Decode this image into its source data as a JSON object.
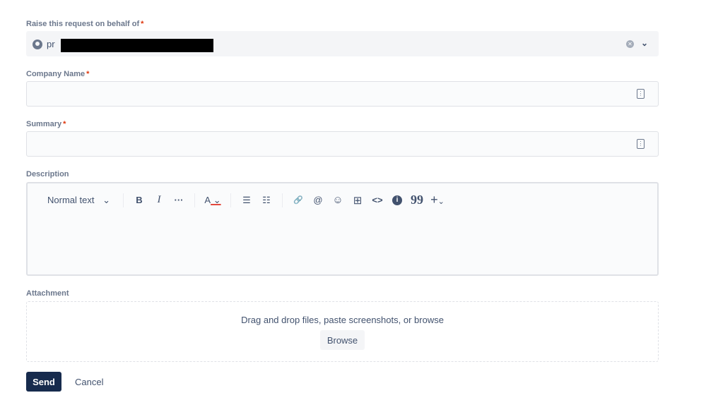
{
  "fields": {
    "behalf": {
      "label": "Raise this request on behalf of",
      "required": "*",
      "value": "pr"
    },
    "company": {
      "label": "Company Name",
      "required": "*"
    },
    "summary": {
      "label": "Summary",
      "required": "*"
    },
    "description": {
      "label": "Description"
    },
    "attachment": {
      "label": "Attachment",
      "drop_text": "Drag and drop files, paste screenshots, or browse",
      "browse": "Browse"
    }
  },
  "toolbar": {
    "text_style": "Normal text",
    "bold": "B",
    "italic": "I",
    "more": "···",
    "color": "A",
    "bullet": "☰",
    "numbered": "☷",
    "link": "🔗",
    "mention": "@",
    "emoji": "☺",
    "table": "⊞",
    "code": "<>",
    "info": "i",
    "quote": "99",
    "insert": "+"
  },
  "actions": {
    "send": "Send",
    "cancel": "Cancel"
  }
}
